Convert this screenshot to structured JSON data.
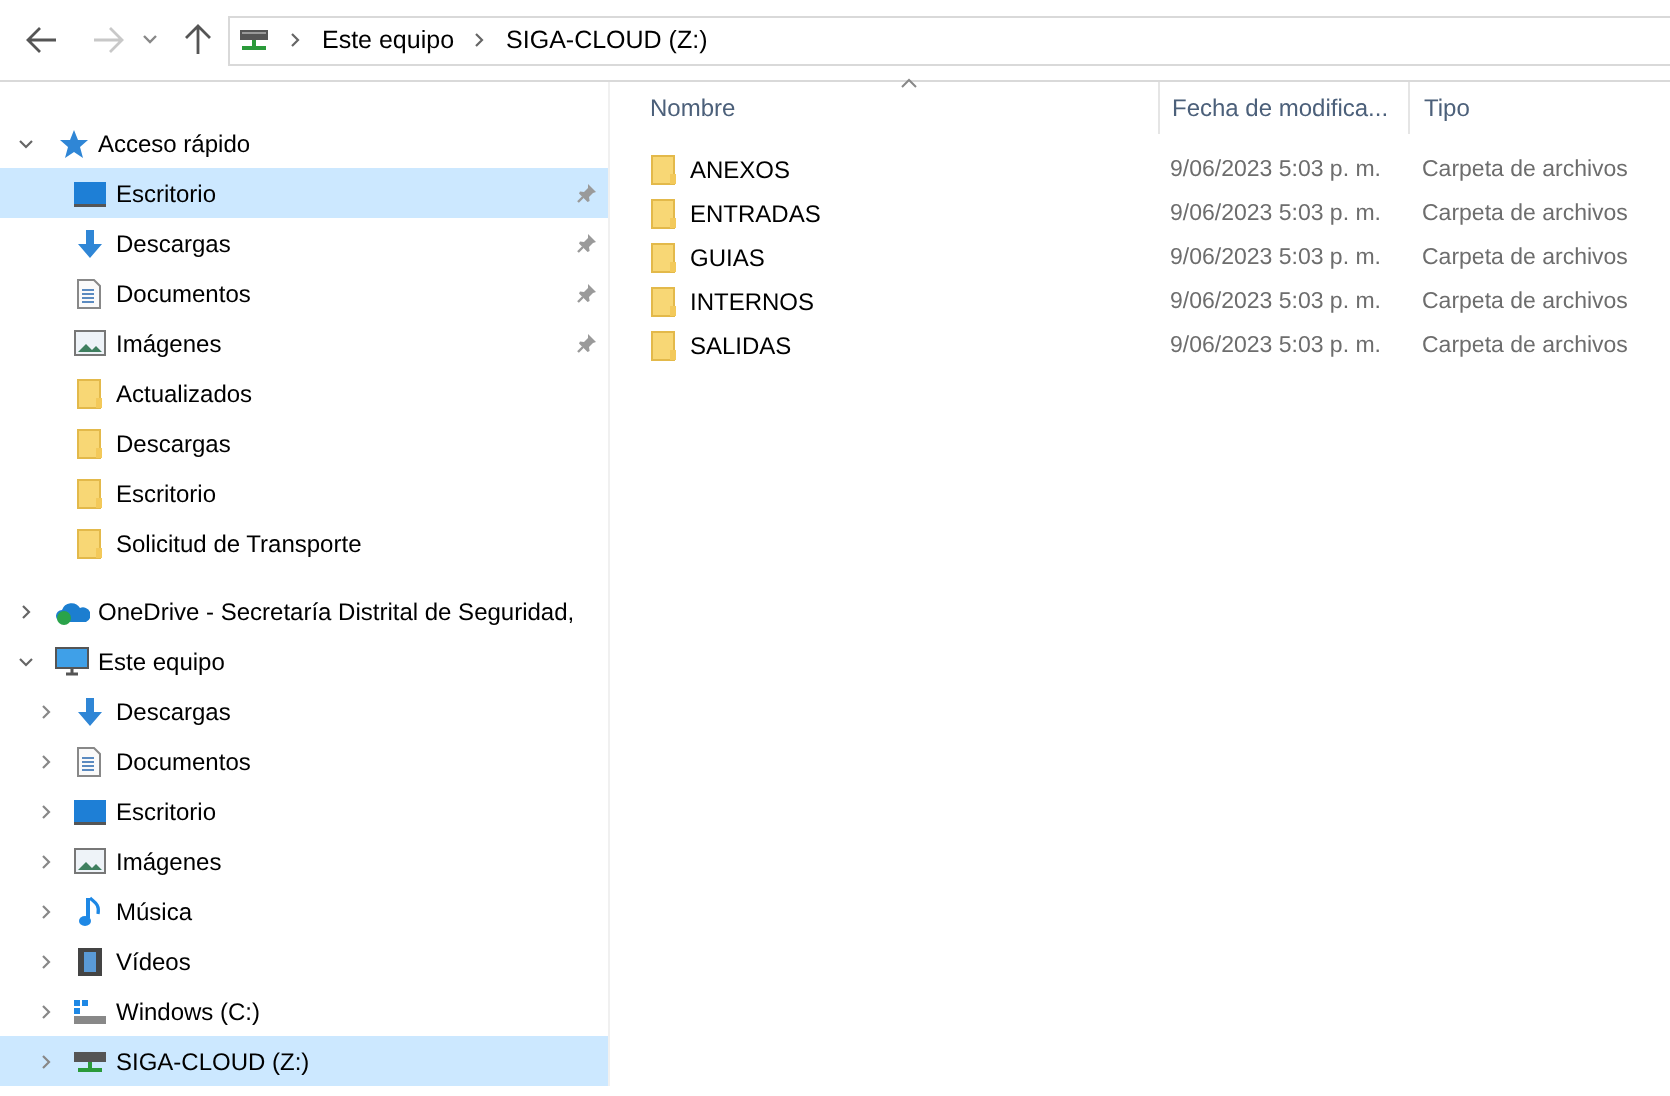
{
  "address": {
    "crumbs": [
      "Este equipo",
      "SIGA-CLOUD (Z:)"
    ]
  },
  "sidebar": {
    "sections": [
      {
        "label": "Acceso rápido",
        "kind": "star",
        "expanded": true,
        "selected": false,
        "children": [
          {
            "label": "Escritorio",
            "kind": "desktop",
            "pinned": true,
            "selected": true
          },
          {
            "label": "Descargas",
            "kind": "download",
            "pinned": true,
            "selected": false
          },
          {
            "label": "Documentos",
            "kind": "document",
            "pinned": true,
            "selected": false
          },
          {
            "label": "Imágenes",
            "kind": "pictures",
            "pinned": true,
            "selected": false
          },
          {
            "label": "Actualizados",
            "kind": "folder",
            "pinned": false,
            "selected": false
          },
          {
            "label": "Descargas",
            "kind": "folder",
            "pinned": false,
            "selected": false
          },
          {
            "label": "Escritorio",
            "kind": "folder",
            "pinned": false,
            "selected": false
          },
          {
            "label": "Solicitud de Transporte",
            "kind": "folder",
            "pinned": false,
            "selected": false
          }
        ]
      },
      {
        "label": "OneDrive - Secretaría Distrital de Seguridad,",
        "kind": "cloud",
        "expanded": false,
        "selected": false
      },
      {
        "label": "Este equipo",
        "kind": "pc",
        "expanded": true,
        "selected": false,
        "children": [
          {
            "label": "Descargas",
            "kind": "download",
            "expanded": false,
            "selected": false
          },
          {
            "label": "Documentos",
            "kind": "document",
            "expanded": false,
            "selected": false
          },
          {
            "label": "Escritorio",
            "kind": "desktop",
            "expanded": false,
            "selected": false
          },
          {
            "label": "Imágenes",
            "kind": "pictures",
            "expanded": false,
            "selected": false
          },
          {
            "label": "Música",
            "kind": "music",
            "expanded": false,
            "selected": false
          },
          {
            "label": "Vídeos",
            "kind": "video",
            "expanded": false,
            "selected": false
          },
          {
            "label": "Windows (C:)",
            "kind": "drive",
            "expanded": false,
            "selected": false
          },
          {
            "label": "SIGA-CLOUD (Z:)",
            "kind": "netdrive",
            "expanded": false,
            "selected": true
          }
        ]
      }
    ]
  },
  "files": {
    "columns": [
      "Nombre",
      "Fecha de modifica...",
      "Tipo"
    ],
    "rows": [
      {
        "name": "ANEXOS",
        "date": "9/06/2023 5:03 p. m.",
        "type": "Carpeta de archivos"
      },
      {
        "name": "ENTRADAS",
        "date": "9/06/2023 5:03 p. m.",
        "type": "Carpeta de archivos"
      },
      {
        "name": "GUIAS",
        "date": "9/06/2023 5:03 p. m.",
        "type": "Carpeta de archivos"
      },
      {
        "name": "INTERNOS",
        "date": "9/06/2023 5:03 p. m.",
        "type": "Carpeta de archivos"
      },
      {
        "name": "SALIDAS",
        "date": "9/06/2023 5:03 p. m.",
        "type": "Carpeta de archivos"
      }
    ]
  }
}
